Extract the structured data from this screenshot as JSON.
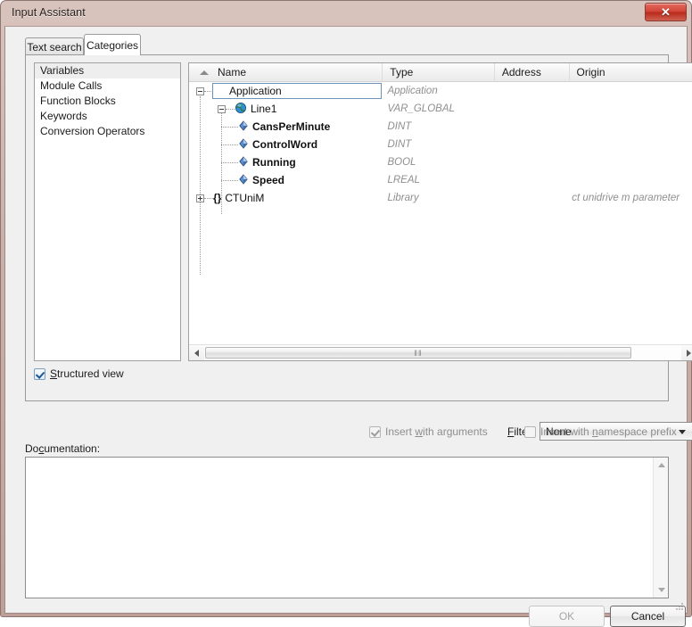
{
  "window": {
    "title": "Input Assistant",
    "close_icon": "close-icon",
    "close_label": "✕"
  },
  "tabs": [
    {
      "label": "Text search",
      "active": false
    },
    {
      "label": "Categories",
      "active": true
    }
  ],
  "categories": {
    "items": [
      {
        "label": "Variables",
        "selected": true
      },
      {
        "label": "Module Calls",
        "selected": false
      },
      {
        "label": "Function Blocks",
        "selected": false
      },
      {
        "label": "Keywords",
        "selected": false
      },
      {
        "label": "Conversion Operators",
        "selected": false
      }
    ]
  },
  "structured_view": {
    "label_pre": "S",
    "label_post": "tructured view",
    "checked": true,
    "enabled": true
  },
  "tree": {
    "columns": [
      {
        "key": "name",
        "label": "Name",
        "sorted": "asc"
      },
      {
        "key": "type",
        "label": "Type"
      },
      {
        "key": "address",
        "label": "Address"
      },
      {
        "key": "origin",
        "label": "Origin"
      }
    ],
    "rows": [
      {
        "name": "Application",
        "type": "Application",
        "address": "",
        "origin": "",
        "icon": "gear-icon",
        "depth": 0,
        "expander": "minus",
        "bold": false,
        "focused": true
      },
      {
        "name": "Line1",
        "type": "VAR_GLOBAL",
        "address": "",
        "origin": "",
        "icon": "globe-icon",
        "depth": 1,
        "expander": "minus",
        "bold": false,
        "focused": false
      },
      {
        "name": "CansPerMinute",
        "type": "DINT",
        "address": "",
        "origin": "",
        "icon": "variable-diamond-icon",
        "depth": 2,
        "expander": "none",
        "bold": true,
        "focused": false
      },
      {
        "name": "ControlWord",
        "type": "DINT",
        "address": "",
        "origin": "",
        "icon": "variable-diamond-icon",
        "depth": 2,
        "expander": "none",
        "bold": true,
        "focused": false
      },
      {
        "name": "Running",
        "type": "BOOL",
        "address": "",
        "origin": "",
        "icon": "variable-diamond-icon",
        "depth": 2,
        "expander": "none",
        "bold": true,
        "focused": false
      },
      {
        "name": "Speed",
        "type": "LREAL",
        "address": "",
        "origin": "",
        "icon": "variable-diamond-icon",
        "depth": 2,
        "expander": "none",
        "bold": true,
        "focused": false
      },
      {
        "name": "CTUniM",
        "type": "Library",
        "address": "",
        "origin": "ct unidrive m parameter",
        "icon": "braces-icon",
        "depth": 0,
        "expander": "plus",
        "bold": false,
        "focused": false
      }
    ],
    "hscroll": {
      "left_arrow": "scroll-left-icon",
      "right_arrow": "scroll-right-icon",
      "grip": "‖‖"
    }
  },
  "filter": {
    "label_pre": "F",
    "label_post": "ilter:",
    "value": "None",
    "options": [
      "None"
    ]
  },
  "insert_options": {
    "with_arguments": {
      "pre": "Insert ",
      "key": "w",
      "post": "ith arguments",
      "checked": true,
      "enabled": false
    },
    "with_namespace_prefix": {
      "pre": "Insert with ",
      "key": "n",
      "post": "amespace prefix",
      "checked": false,
      "enabled": false
    }
  },
  "documentation": {
    "label_pre": "Do",
    "label_key": "c",
    "label_post": "umentation:",
    "value": ""
  },
  "buttons": {
    "ok": {
      "label": "OK",
      "enabled": false
    },
    "cancel": {
      "label": "Cancel",
      "enabled": true
    }
  },
  "colors": {
    "titlebar_start": "#d9c3bd",
    "titlebar_end": "#bfa099",
    "close_red": "#c8382a",
    "selection_grey": "#eeeeee",
    "focus_blue": "#6d93b8",
    "type_text": "#8f8f8f"
  }
}
